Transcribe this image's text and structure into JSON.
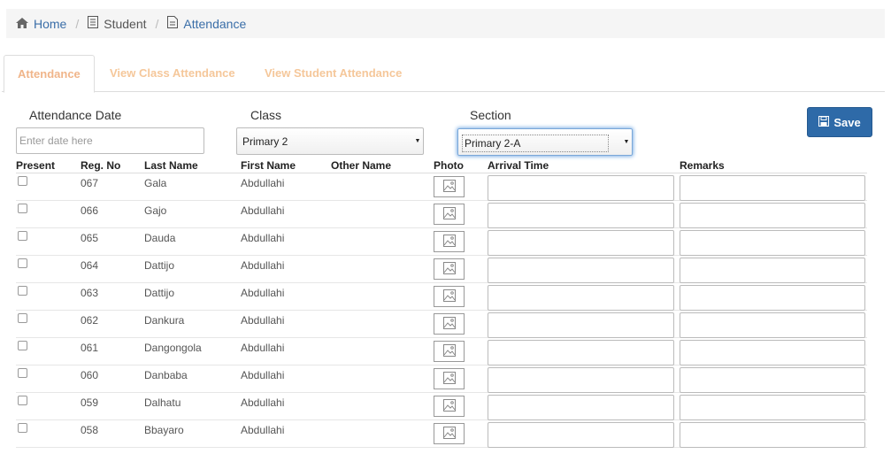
{
  "breadcrumb": {
    "home": "Home",
    "student": "Student",
    "attendance": "Attendance"
  },
  "tabs": [
    "Attendance",
    "View Class Attendance",
    "View Student Attendance"
  ],
  "filters": {
    "date_label": "Attendance Date",
    "date_placeholder": "Enter date here",
    "class_label": "Class",
    "class_value": "Primary 2",
    "section_label": "Section",
    "section_value": "Primary 2-A"
  },
  "save_label": "Save",
  "columns": [
    "Present",
    "Reg. No",
    "Last Name",
    "First Name",
    "Other Name",
    "Photo",
    "Arrival Time",
    "Remarks"
  ],
  "rows": [
    {
      "reg": "067",
      "last": "Gala",
      "first": "Abdullahi",
      "other": ""
    },
    {
      "reg": "066",
      "last": "Gajo",
      "first": "Abdullahi",
      "other": ""
    },
    {
      "reg": "065",
      "last": "Dauda",
      "first": "Abdullahi",
      "other": ""
    },
    {
      "reg": "064",
      "last": "Dattijo",
      "first": "Abdullahi",
      "other": ""
    },
    {
      "reg": "063",
      "last": "Dattijo",
      "first": "Abdullahi",
      "other": ""
    },
    {
      "reg": "062",
      "last": "Dankura",
      "first": "Abdullahi",
      "other": ""
    },
    {
      "reg": "061",
      "last": "Dangongola",
      "first": "Abdullahi",
      "other": ""
    },
    {
      "reg": "060",
      "last": "Danbaba",
      "first": "Abdullahi",
      "other": ""
    },
    {
      "reg": "059",
      "last": "Dalhatu",
      "first": "Abdullahi",
      "other": ""
    },
    {
      "reg": "058",
      "last": "Bbayaro",
      "first": "Abdullahi",
      "other": ""
    }
  ],
  "icons": {
    "home": "home-icon",
    "student": "document-icon",
    "attendance": "document-icon",
    "save": "floppy-disk-icon",
    "photo": "image-placeholder-icon"
  },
  "colors": {
    "link": "#3a6ea8",
    "tab_text": "#f5c79a",
    "save_button": "#2e6aa8"
  }
}
